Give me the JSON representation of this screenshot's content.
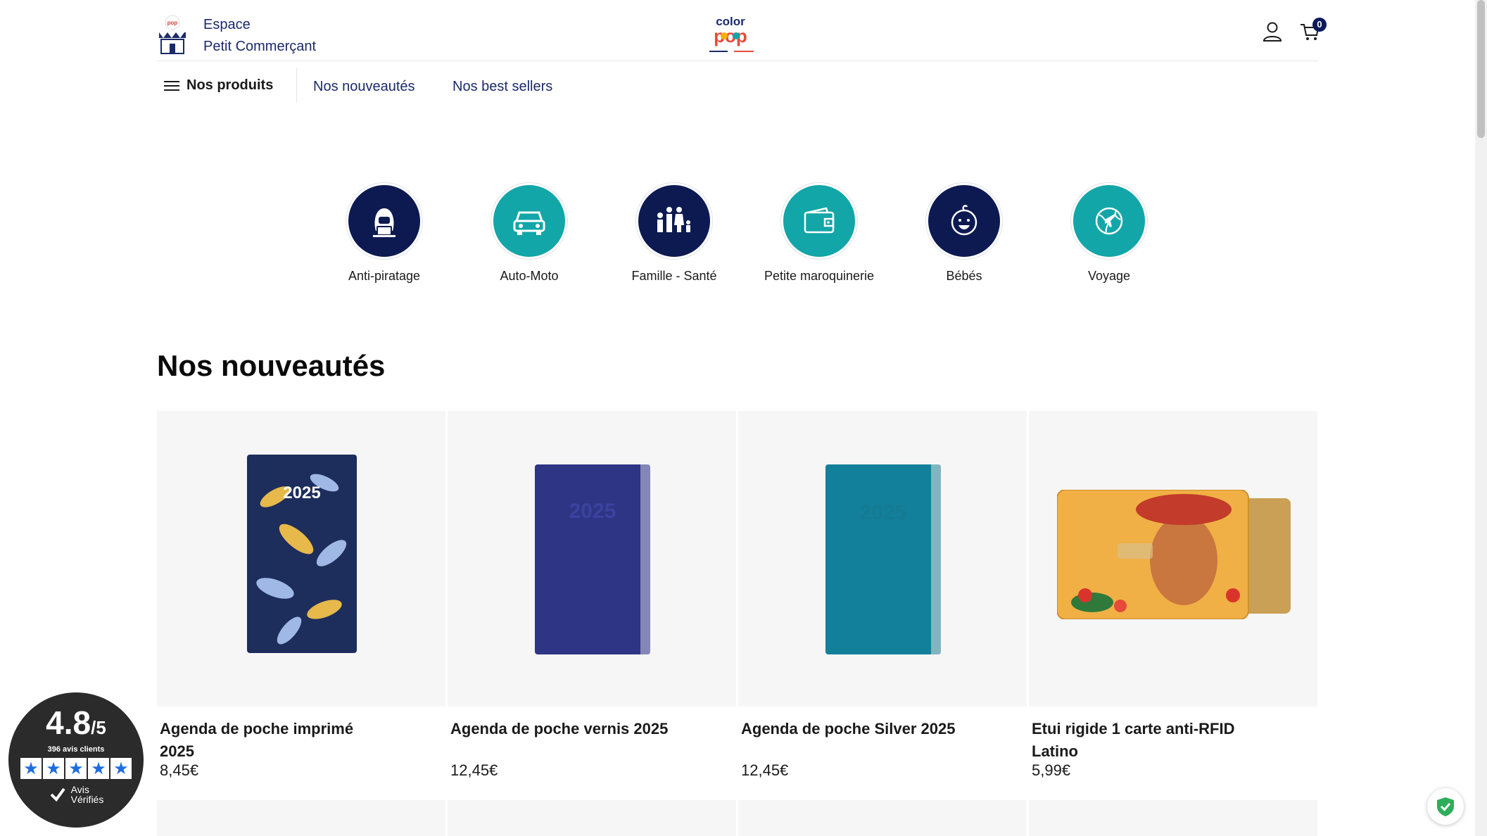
{
  "header": {
    "shop_line1": "Espace",
    "shop_line2": "Petit Commerçant",
    "cart_count": "0"
  },
  "nav": {
    "menu_label": "Nos produits",
    "links": [
      "Nos nouveautés",
      "Nos best sellers"
    ]
  },
  "categories": [
    {
      "label": "Anti-piratage",
      "icon": "hacker-icon",
      "color": "#0d1a52"
    },
    {
      "label": "Auto-Moto",
      "icon": "car-icon",
      "color": "#12a6a8"
    },
    {
      "label": "Famille - Santé",
      "icon": "family-icon",
      "color": "#0d1a52"
    },
    {
      "label": "Petite maroquinerie",
      "icon": "wallet-icon",
      "color": "#12a6a8"
    },
    {
      "label": "Bébés",
      "icon": "baby-icon",
      "color": "#0d1a52"
    },
    {
      "label": "Voyage",
      "icon": "globe-plane-icon",
      "color": "#12a6a8"
    }
  ],
  "section": {
    "title": "Nos nouveautés"
  },
  "products": [
    {
      "name": "Agenda de poche imprimé 2025",
      "price": "8,45€",
      "image": "floral-agenda-image"
    },
    {
      "name": "Agenda de poche vernis 2025",
      "price": "12,45€",
      "image": "navy-agenda-image"
    },
    {
      "name": "Agenda de poche Silver 2025",
      "price": "12,45€",
      "image": "teal-agenda-image"
    },
    {
      "name": "Etui rigide 1 carte anti-RFID Latino",
      "price": "5,99€",
      "image": "card-case-image"
    }
  ],
  "reviews": {
    "score": "4.8",
    "out_of": "/5",
    "count": "396 avis clients",
    "brand_line1": "Avis",
    "brand_line2": "Vérifiés"
  }
}
